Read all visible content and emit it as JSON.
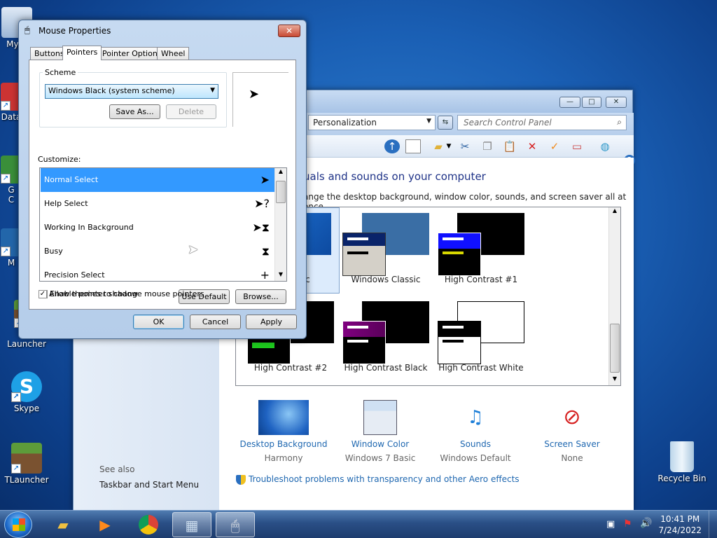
{
  "desktop": {
    "icons": [
      {
        "label": "My C"
      },
      {
        "label": "Data"
      },
      {
        "label": "G\nC"
      },
      {
        "label": "M"
      },
      {
        "label": "M\nLauncher"
      },
      {
        "label": "Skype"
      },
      {
        "label": "TLauncher"
      },
      {
        "label": "Recycle Bin"
      }
    ]
  },
  "control_panel": {
    "address": "Personalization",
    "search_placeholder": "Search Control Panel",
    "heading": "uals and sounds on your computer",
    "subtitle": "ange the desktop background, window color, sounds, and screen saver all at once.",
    "themes": [
      {
        "label": "asic"
      },
      {
        "label": "Windows Classic"
      },
      {
        "label": "High Contrast #1"
      },
      {
        "label": "High Contrast #2"
      },
      {
        "label": "High Contrast Black"
      },
      {
        "label": "High Contrast White"
      }
    ],
    "bottom": [
      {
        "title": "Desktop Background",
        "value": "Harmony"
      },
      {
        "title": "Window Color",
        "value": "Windows 7 Basic"
      },
      {
        "title": "Sounds",
        "value": "Windows Default"
      },
      {
        "title": "Screen Saver",
        "value": "None"
      }
    ],
    "see_also": "See also",
    "see_also_link": "Taskbar and Start Menu",
    "troubleshoot": "Troubleshoot problems with transparency and other Aero effects",
    "colors": {
      "link": "#1e67b0",
      "heading": "#1e3287"
    }
  },
  "mouse_dialog": {
    "title": "Mouse Properties",
    "tabs": [
      "Buttons",
      "Pointers",
      "Pointer Options",
      "Wheel"
    ],
    "active_tab": "Pointers",
    "scheme_label": "Scheme",
    "scheme_value": "Windows Black (system scheme)",
    "save_as": "Save As...",
    "delete": "Delete",
    "customize_label": "Customize:",
    "pointers": [
      {
        "label": "Normal Select",
        "icon": "arrow-cursor-icon"
      },
      {
        "label": "Help Select",
        "icon": "help-cursor-icon"
      },
      {
        "label": "Working In Background",
        "icon": "working-cursor-icon"
      },
      {
        "label": "Busy",
        "icon": "hourglass-cursor-icon"
      },
      {
        "label": "Precision Select",
        "icon": "crosshair-cursor-icon"
      }
    ],
    "enable_shadow": "Enable pointer shadow",
    "use_default": "Use Default",
    "browse": "Browse...",
    "allow_themes": "Allow themes to change mouse pointers",
    "ok": "OK",
    "cancel": "Cancel",
    "apply": "Apply"
  },
  "taskbar": {
    "time": "10:41 PM",
    "date": "7/24/2022"
  }
}
